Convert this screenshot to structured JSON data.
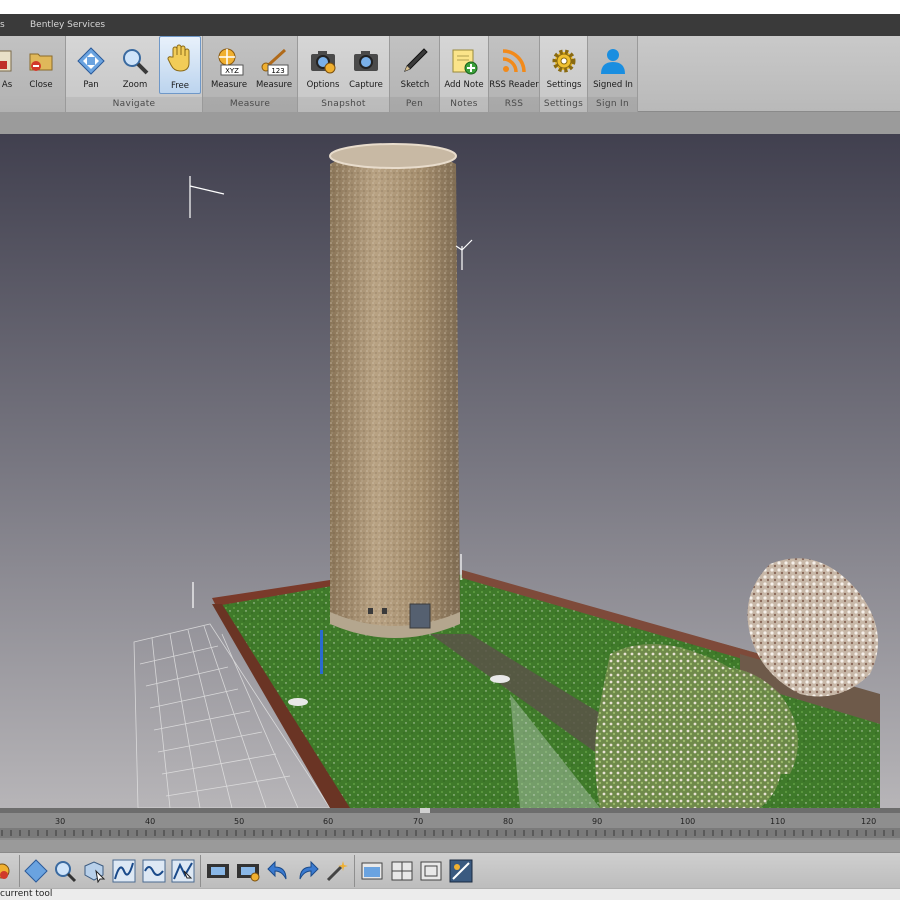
{
  "menu": {
    "items": [
      "s",
      "Bentley Services"
    ]
  },
  "ribbon": {
    "buttons": {
      "save_as": "e As",
      "close": "Close",
      "pan": "Pan",
      "zoom": "Zoom",
      "free": "Free",
      "measure_xyz": "Measure",
      "measure_dist": "Measure",
      "options": "Options",
      "capture": "Capture",
      "sketch": "Sketch",
      "add_note": "Add Note",
      "rss_reader": "RSS Reader",
      "settings": "Settings",
      "signed_in": "Signed In"
    },
    "icon_text": {
      "xyz": "XYZ",
      "num": "123"
    },
    "groups": [
      "Navigate",
      "Measure",
      "Snapshot",
      "Pen",
      "Notes",
      "RSS",
      "Settings",
      "Sign In"
    ]
  },
  "timeline": {
    "ticks": [
      "30",
      "40",
      "50",
      "60",
      "70",
      "80",
      "90",
      "100",
      "110",
      "120"
    ]
  },
  "toolbar": {
    "icons": [
      "point-icon",
      "pan-icon",
      "zoom-icon",
      "box-select-icon",
      "curve-icon",
      "curve-wave-icon",
      "curve-select-icon",
      "film-icon",
      "film-settings-icon",
      "undo-icon",
      "redo-icon",
      "wand-icon",
      "view-single-icon",
      "view-quad-icon",
      "view-frame-icon",
      "screen-icon"
    ]
  },
  "status": {
    "text": "current tool"
  },
  "colors": {
    "accent": "#6f98c8",
    "menubar": "#3a3a3a",
    "grass": "#3f7a2a",
    "tower": "#a58f74"
  }
}
